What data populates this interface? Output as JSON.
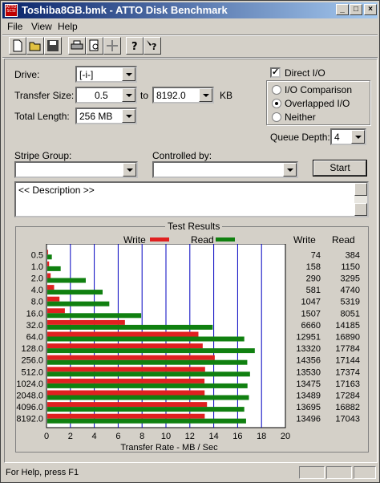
{
  "window": {
    "title": "Toshiba8GB.bmk - ATTO Disk Benchmark",
    "app_icon_text": "ATTO SCSI"
  },
  "menu": {
    "file": "File",
    "view": "View",
    "help": "Help"
  },
  "form": {
    "drive_label": "Drive:",
    "drive_value": "[-i-]",
    "transfer_label": "Transfer Size:",
    "transfer_from": "0.5",
    "to_label": "to",
    "transfer_to": "8192.0",
    "kb_label": "KB",
    "length_label": "Total Length:",
    "length_value": "256 MB",
    "direct_io": "Direct I/O",
    "io_comparison": "I/O Comparison",
    "overlapped_io": "Overlapped I/O",
    "neither": "Neither",
    "queue_label": "Queue Depth:",
    "queue_value": "4",
    "stripe_label": "Stripe Group:",
    "controlled_label": "Controlled by:",
    "start": "Start",
    "description": "<< Description >>"
  },
  "results": {
    "title": "Test Results",
    "legend_write": "Write",
    "legend_read": "Read",
    "col_write": "Write",
    "col_read": "Read",
    "xlabel": "Transfer Rate - MB / Sec"
  },
  "chart_data": {
    "type": "bar",
    "orientation": "horizontal",
    "xlabel": "Transfer Rate - MB / Sec",
    "xlim": [
      0,
      20
    ],
    "xticks": [
      "0",
      "2",
      "4",
      "6",
      "8",
      "10",
      "12",
      "14",
      "16",
      "18",
      "20"
    ],
    "categories": [
      "0.5",
      "1.0",
      "2.0",
      "4.0",
      "8.0",
      "16.0",
      "32.0",
      "64.0",
      "128.0",
      "256.0",
      "512.0",
      "1024.0",
      "2048.0",
      "4096.0",
      "8192.0"
    ],
    "series": [
      {
        "name": "Write",
        "color": "#e02020",
        "values": [
          0.07,
          0.15,
          0.28,
          0.57,
          1.02,
          1.47,
          6.5,
          12.65,
          13.01,
          14.02,
          13.21,
          13.16,
          13.17,
          13.37,
          13.18
        ],
        "labels": [
          "74",
          "158",
          "290",
          "581",
          "1047",
          "1507",
          "6660",
          "12951",
          "13320",
          "14356",
          "13530",
          "13475",
          "13489",
          "13695",
          "13496"
        ]
      },
      {
        "name": "Read",
        "color": "#108010",
        "values": [
          0.38,
          1.12,
          3.22,
          4.63,
          5.19,
          7.86,
          13.85,
          16.49,
          17.37,
          16.74,
          16.97,
          16.76,
          16.88,
          16.49,
          16.64
        ],
        "labels": [
          "384",
          "1150",
          "3295",
          "4740",
          "5319",
          "8051",
          "14185",
          "16890",
          "17784",
          "17144",
          "17374",
          "17163",
          "17284",
          "16882",
          "17043"
        ]
      }
    ],
    "grid": true,
    "legend": "top"
  },
  "status": {
    "text": "For Help, press F1"
  },
  "colors": {
    "accent": "#0a246a",
    "write": "#e02020",
    "read": "#108010",
    "grid": "#0000c0"
  }
}
